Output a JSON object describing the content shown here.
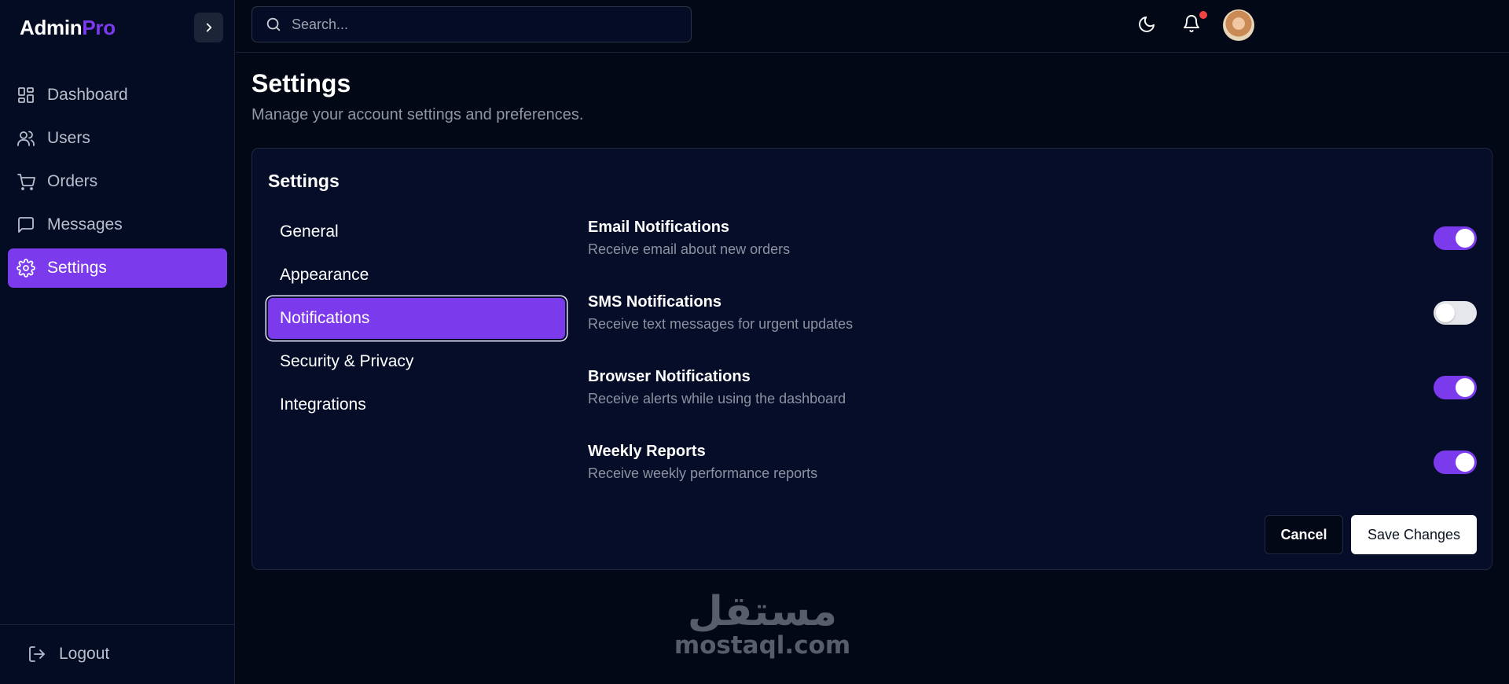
{
  "brand": {
    "part1": "Admin",
    "part2": "Pro"
  },
  "sidebar": {
    "items": [
      {
        "label": "Dashboard",
        "icon": "dashboard-icon"
      },
      {
        "label": "Users",
        "icon": "users-icon"
      },
      {
        "label": "Orders",
        "icon": "cart-icon"
      },
      {
        "label": "Messages",
        "icon": "message-icon"
      },
      {
        "label": "Settings",
        "icon": "gear-icon",
        "active": true
      }
    ],
    "logout_label": "Logout"
  },
  "header": {
    "search_placeholder": "Search...",
    "notifications_unread": true
  },
  "page": {
    "title": "Settings",
    "subtitle": "Manage your account settings and preferences."
  },
  "card": {
    "title": "Settings",
    "tabs": [
      {
        "label": "General"
      },
      {
        "label": "Appearance"
      },
      {
        "label": "Notifications",
        "active": true
      },
      {
        "label": "Security & Privacy"
      },
      {
        "label": "Integrations"
      }
    ],
    "settings": [
      {
        "title": "Email Notifications",
        "description": "Receive email about new orders",
        "enabled": true
      },
      {
        "title": "SMS Notifications",
        "description": "Receive text messages for urgent updates",
        "enabled": false
      },
      {
        "title": "Browser Notifications",
        "description": "Receive alerts while using the dashboard",
        "enabled": true
      },
      {
        "title": "Weekly Reports",
        "description": "Receive weekly performance reports",
        "enabled": true
      }
    ],
    "cancel_label": "Cancel",
    "save_label": "Save Changes"
  },
  "watermark": {
    "arabic": "مستقل",
    "latin": "mostaql.com"
  },
  "colors": {
    "accent": "#7c3aed",
    "background": "#030817",
    "sidebar": "#040c24",
    "danger": "#ef4444"
  }
}
